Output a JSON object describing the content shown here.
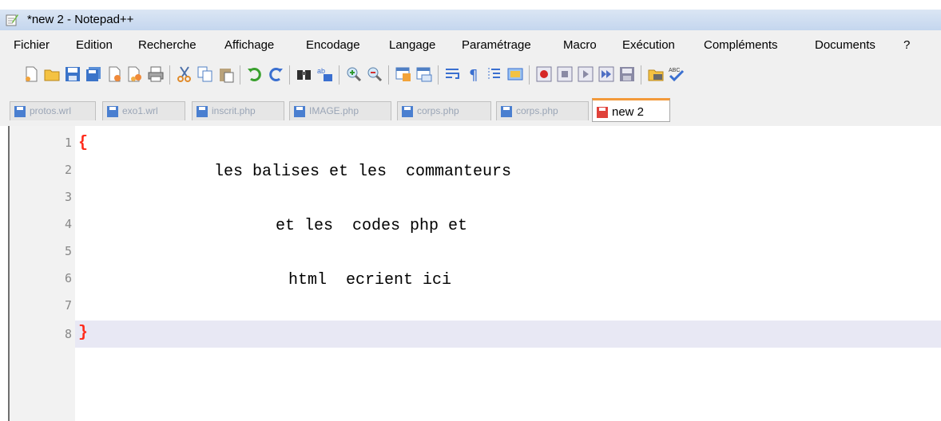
{
  "window": {
    "title": "*new  2 - Notepad++"
  },
  "menu": [
    "Fichier",
    "Edition",
    "Recherche",
    "Affichage",
    "Encodage",
    "Langage",
    "Paramétrage",
    "Macro",
    "Exécution",
    "Compléments",
    "Documents",
    "?"
  ],
  "toolbar": {
    "buttons": [
      "new-file",
      "open-file",
      "save",
      "save-all",
      "close",
      "close-all",
      "print",
      "cut",
      "copy",
      "paste",
      "undo",
      "redo",
      "find",
      "replace",
      "zoom-in",
      "zoom-out",
      "sync-vertical",
      "sync-horizontal",
      "word-wrap",
      "show-all-chars",
      "indent-guide",
      "user-lang",
      "record-macro",
      "stop-record",
      "play-macro",
      "run-macro-multiple",
      "save-macro",
      "launch-run",
      "spell-check"
    ]
  },
  "tabs": [
    {
      "label": "protos.wrl",
      "active": false
    },
    {
      "label": "exo1.wrl",
      "active": false
    },
    {
      "label": "inscrit.php",
      "active": false
    },
    {
      "label": "IMAGE.php",
      "active": false
    },
    {
      "label": "corps.php",
      "active": false
    },
    {
      "label": "corps.php",
      "active": false
    },
    {
      "label": "new 2",
      "active": true
    }
  ],
  "editor": {
    "line_numbers": [
      "1",
      "2",
      "3",
      "4",
      "5",
      "6",
      "7",
      "8"
    ],
    "lines": {
      "l1": "{",
      "l2": "les balises et les  commanteurs",
      "l4": "et les  codes php et",
      "l6": "html  ecrient ici",
      "l8": "}"
    },
    "current_line": 8
  },
  "colors": {
    "brace": "#ff2a1a",
    "active_tab_accent": "#f39a3a",
    "current_line_bg": "#e8e8f4"
  }
}
